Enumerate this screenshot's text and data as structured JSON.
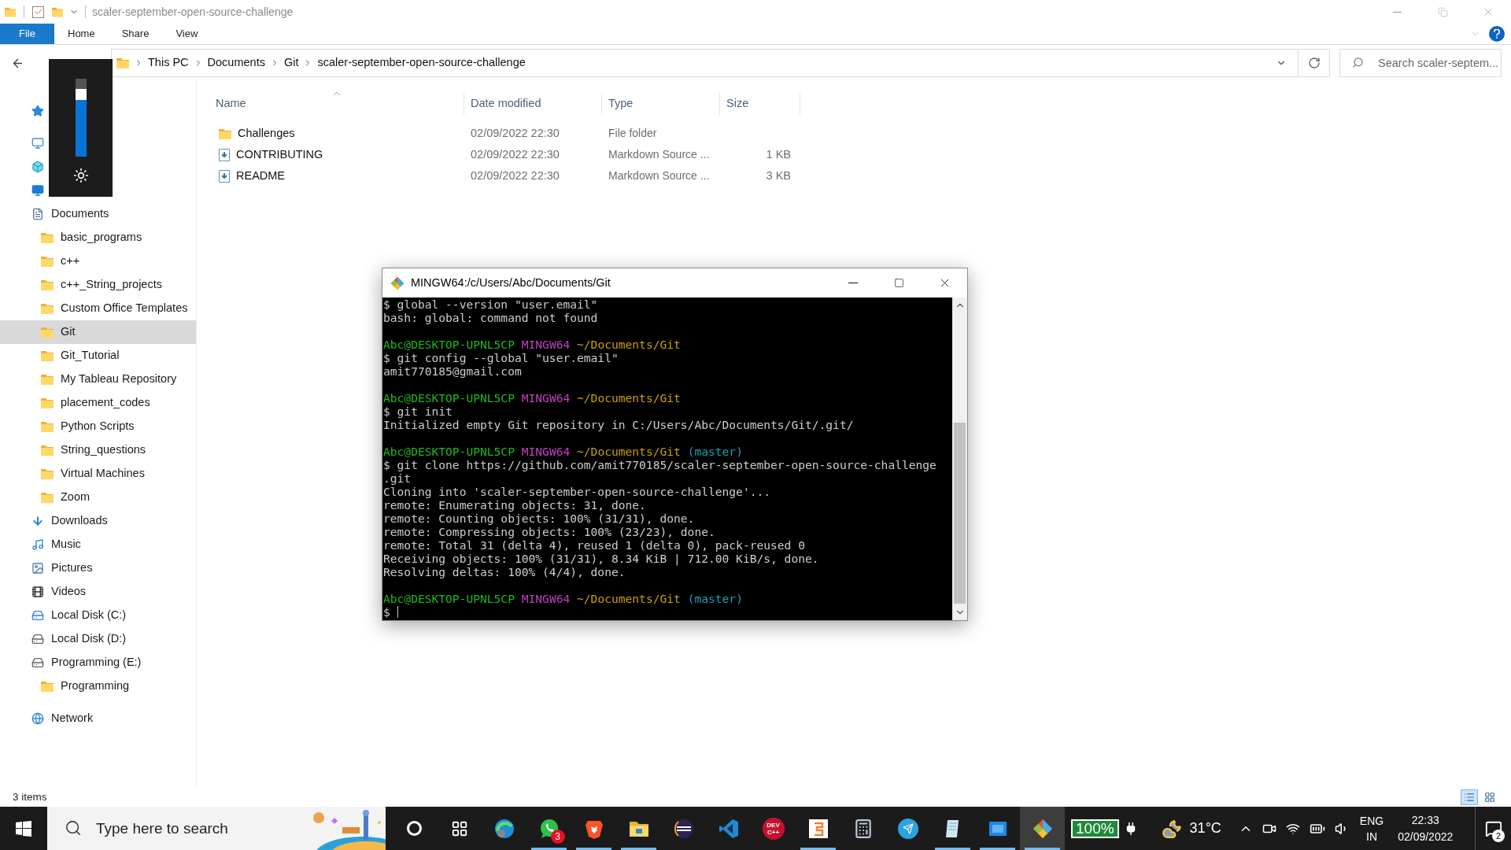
{
  "explorer": {
    "title": "scaler-september-open-source-challenge",
    "ribbon_tabs": [
      {
        "label": "File",
        "selected": true
      },
      {
        "label": "Home",
        "selected": false
      },
      {
        "label": "Share",
        "selected": false
      },
      {
        "label": "View",
        "selected": false
      }
    ],
    "breadcrumb": [
      "This PC",
      "Documents",
      "Git",
      "scaler-september-open-source-challenge"
    ],
    "search": {
      "placeholder": "Search scaler-septem..."
    },
    "sidebar": {
      "items": [
        {
          "kind": "star",
          "selected": false
        },
        {
          "kind": "pc",
          "selected": false,
          "children": [
            {
              "kind": "cube",
              "selected": false
            },
            {
              "kind": "desktop",
              "selected": false
            },
            {
              "kind": "documents",
              "label": "Documents",
              "selected": false,
              "children": [
                {
                  "kind": "folder",
                  "label": "basic_programs",
                  "selected": false
                },
                {
                  "kind": "folder",
                  "label": "c++",
                  "selected": false
                },
                {
                  "kind": "folder",
                  "label": "c++_String_projects",
                  "selected": false
                },
                {
                  "kind": "folder",
                  "label": "Custom Office Templates",
                  "selected": false
                },
                {
                  "kind": "folder",
                  "label": "Git",
                  "selected": true
                },
                {
                  "kind": "folder",
                  "label": "Git_Tutorial",
                  "selected": false
                },
                {
                  "kind": "folder",
                  "label": "My Tableau Repository",
                  "selected": false
                },
                {
                  "kind": "folder",
                  "label": "placement_codes",
                  "selected": false
                },
                {
                  "kind": "folder",
                  "label": "Python Scripts",
                  "selected": false
                },
                {
                  "kind": "folder",
                  "label": "String_questions",
                  "selected": false
                },
                {
                  "kind": "folder",
                  "label": "Virtual Machines",
                  "selected": false
                },
                {
                  "kind": "folder",
                  "label": "Zoom",
                  "selected": false
                }
              ]
            },
            {
              "kind": "downloads",
              "label": "Downloads",
              "selected": false
            },
            {
              "kind": "music",
              "label": "Music",
              "selected": false
            },
            {
              "kind": "pictures",
              "label": "Pictures",
              "selected": false
            },
            {
              "kind": "videos",
              "label": "Videos",
              "selected": false
            },
            {
              "kind": "system-disk",
              "label": "Local Disk (C:)",
              "selected": false
            },
            {
              "kind": "disk",
              "label": "Local Disk (D:)",
              "selected": false
            },
            {
              "kind": "disk",
              "label": "Programming (E:)",
              "selected": false,
              "children": [
                {
                  "kind": "folder",
                  "label": "Programming",
                  "selected": false
                }
              ]
            }
          ]
        },
        {
          "kind": "network",
          "label": "Network",
          "selected": false
        }
      ]
    },
    "table": {
      "columns": [
        {
          "label": "Name",
          "sorted": true
        },
        {
          "label": "Date modified",
          "sorted": false
        },
        {
          "label": "Type",
          "sorted": false
        },
        {
          "label": "Size",
          "sorted": false
        }
      ],
      "rows": [
        {
          "kind": "folder",
          "name": "Challenges",
          "date": "02/09/2022 22:30",
          "type": "File folder"
        },
        {
          "kind": "markdown",
          "name": "CONTRIBUTING",
          "date": "02/09/2022 22:30",
          "type": "Markdown Source ...",
          "size": "1 KB"
        },
        {
          "kind": "markdown",
          "name": "README",
          "date": "02/09/2022 22:30",
          "type": "Markdown Source ...",
          "size": "3 KB"
        }
      ]
    },
    "status_bar": {
      "count": "3 items"
    }
  },
  "brightness": {
    "level": 0.87
  },
  "terminal": {
    "title": "MINGW64:/c/Users/Abc/Documents/Git",
    "lines": [
      {
        "kind": "text",
        "text": "$ global --version \"user.email\""
      },
      {
        "kind": "text",
        "text": "bash: global: command not found"
      },
      {
        "kind": "blank"
      },
      {
        "kind": "prompt",
        "user": "Abc@DESKTOP-UPNL5CP",
        "shell": "MINGW64",
        "path": "~/Documents/Git"
      },
      {
        "kind": "text",
        "text": "$ git config --global \"user.email\""
      },
      {
        "kind": "text",
        "text": "amit770185@gmail.com"
      },
      {
        "kind": "blank"
      },
      {
        "kind": "prompt",
        "user": "Abc@DESKTOP-UPNL5CP",
        "shell": "MINGW64",
        "path": "~/Documents/Git"
      },
      {
        "kind": "text",
        "text": "$ git init"
      },
      {
        "kind": "text",
        "text": "Initialized empty Git repository in C:/Users/Abc/Documents/Git/.git/"
      },
      {
        "kind": "blank"
      },
      {
        "kind": "prompt",
        "user": "Abc@DESKTOP-UPNL5CP",
        "shell": "MINGW64",
        "path": "~/Documents/Git",
        "branch": "(master)"
      },
      {
        "kind": "text",
        "text": "$ git clone https://github.com/amit770185/scaler-september-open-source-challenge"
      },
      {
        "kind": "text",
        "text": ".git"
      },
      {
        "kind": "text",
        "text": "Cloning into 'scaler-september-open-source-challenge'..."
      },
      {
        "kind": "text",
        "text": "remote: Enumerating objects: 31, done."
      },
      {
        "kind": "text",
        "text": "remote: Counting objects: 100% (31/31), done."
      },
      {
        "kind": "text",
        "text": "remote: Compressing objects: 100% (23/23), done."
      },
      {
        "kind": "text",
        "text": "remote: Total 31 (delta 4), reused 1 (delta 0), pack-reused 0"
      },
      {
        "kind": "text",
        "text": "Receiving objects: 100% (31/31), 8.34 KiB | 712.00 KiB/s, done."
      },
      {
        "kind": "text",
        "text": "Resolving deltas: 100% (4/4), done."
      },
      {
        "kind": "blank"
      },
      {
        "kind": "prompt",
        "user": "Abc@DESKTOP-UPNL5CP",
        "shell": "MINGW64",
        "path": "~/Documents/Git",
        "branch": "(master)"
      },
      {
        "kind": "input",
        "text": "$"
      }
    ]
  },
  "taskbar": {
    "search": {
      "placeholder": "Type here to search"
    },
    "apps": [
      {
        "kind": "cortana",
        "running": false,
        "selected": false
      },
      {
        "kind": "taskview",
        "running": false,
        "selected": false
      },
      {
        "kind": "edge",
        "running": false,
        "selected": false
      },
      {
        "kind": "whatsapp",
        "running": true,
        "selected": false,
        "badge": "3"
      },
      {
        "kind": "brave",
        "running": true,
        "selected": false
      },
      {
        "kind": "explorer",
        "running": true,
        "selected": false
      },
      {
        "kind": "eclipse",
        "running": false,
        "selected": false
      },
      {
        "kind": "vscode",
        "running": false,
        "selected": false
      },
      {
        "kind": "devcpp",
        "running": false,
        "selected": false,
        "label": "DEV C++"
      },
      {
        "kind": "sublime",
        "running": true,
        "selected": false
      },
      {
        "kind": "calculator",
        "running": false,
        "selected": false
      },
      {
        "kind": "telegram",
        "running": false,
        "selected": false
      },
      {
        "kind": "notepad",
        "running": true,
        "selected": false
      },
      {
        "kind": "store",
        "running": true,
        "selected": false
      },
      {
        "kind": "git",
        "running": true,
        "selected": true
      }
    ],
    "battery_widget": "100%",
    "weather": "31°C",
    "language": "ENG",
    "region": "IN",
    "time": "22:33",
    "date": "02/09/2022",
    "notifications": "2"
  }
}
